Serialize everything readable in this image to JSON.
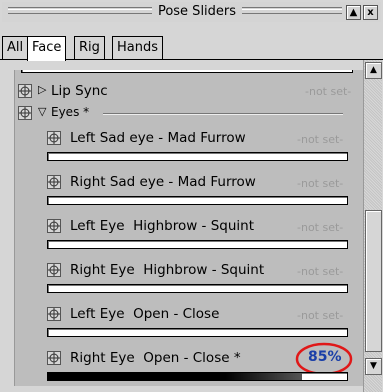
{
  "window": {
    "title": "Pose Sliders",
    "dock_button": "▲",
    "close_button": "x"
  },
  "tabs": [
    {
      "label": "All"
    },
    {
      "label": "Face",
      "active": true
    },
    {
      "label": "Rig"
    },
    {
      "label": "Hands"
    }
  ],
  "groups": [
    {
      "label": "Lip Sync",
      "expanded": false,
      "expander": "▷",
      "value": "-not set-"
    },
    {
      "label": "Eyes *",
      "expanded": true,
      "expander": "▽"
    }
  ],
  "sliders": [
    {
      "label": "Left Sad eye - Mad Furrow",
      "value": "-not set-"
    },
    {
      "label": "Right Sad eye - Mad Furrow",
      "value": "-not set-"
    },
    {
      "label": "Left Eye  Highbrow - Squint",
      "value": "-not set-"
    },
    {
      "label": "Right Eye  Highbrow - Squint",
      "value": "-not set-"
    },
    {
      "label": "Left Eye  Open - Close",
      "value": "-not set-"
    },
    {
      "label": "Right Eye  Open - Close *",
      "value": "85%",
      "fill": 0.85,
      "highlighted": true
    }
  ],
  "scrollbar": {
    "up": "▲",
    "down": "▼"
  },
  "colors": {
    "value_highlight": "#1a3fa8",
    "annotation_circle": "#e01818",
    "not_set_text": "#9a9a9a",
    "panel_bg": "#bdbdbd"
  }
}
